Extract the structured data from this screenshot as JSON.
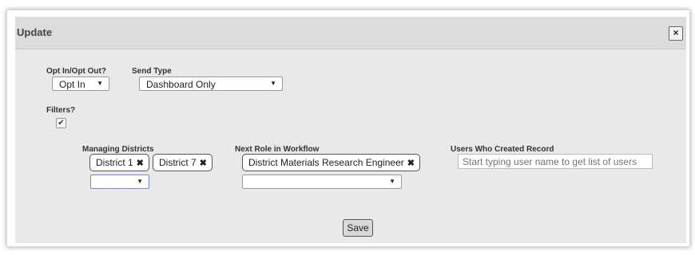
{
  "dialog": {
    "title": "Update",
    "close_label": "×"
  },
  "opt": {
    "label": "Opt In/Opt Out?",
    "value": "Opt In"
  },
  "send_type": {
    "label": "Send Type",
    "value": "Dashboard Only"
  },
  "filters": {
    "label": "Filters?",
    "checked": true,
    "check_glyph": "✔"
  },
  "managing_districts": {
    "label": "Managing Districts",
    "chips": [
      "District 1",
      "District 7"
    ],
    "select_value": ""
  },
  "next_role": {
    "label": "Next Role in Workflow",
    "chips": [
      "District Materials Research Engineer"
    ],
    "select_value": ""
  },
  "users_created": {
    "label": "Users Who Created Record",
    "placeholder": "Start typing user name to get list of users"
  },
  "chip_remove_glyph": "✖",
  "dropdown_glyph": "▼",
  "save_label": "Save"
}
